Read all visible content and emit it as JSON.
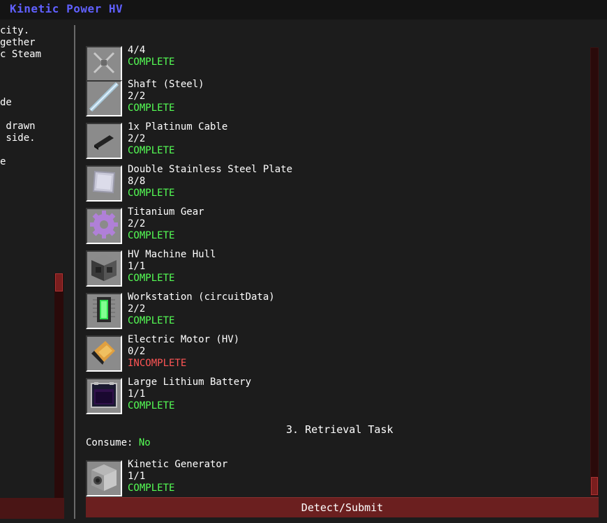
{
  "window": {
    "title": "Kinetic Power HV"
  },
  "description": {
    "lines": [
      "city.",
      "gether",
      "c Steam",
      "de",
      " drawn",
      " side.",
      "e"
    ]
  },
  "requirements": [
    {
      "icon": "rotor-icon",
      "name": "",
      "count": "4/4",
      "status": "COMPLETE"
    },
    {
      "icon": "steel-shaft-icon",
      "name": "Shaft (Steel)",
      "count": "2/2",
      "status": "COMPLETE"
    },
    {
      "icon": "platinum-cable-icon",
      "name": "1x Platinum Cable",
      "count": "2/2",
      "status": "COMPLETE"
    },
    {
      "icon": "steel-plate-icon",
      "name": "Double Stainless Steel Plate",
      "count": "8/8",
      "status": "COMPLETE"
    },
    {
      "icon": "titanium-gear-icon",
      "name": "Titanium Gear",
      "count": "2/2",
      "status": "COMPLETE"
    },
    {
      "icon": "machine-hull-icon",
      "name": "HV Machine Hull",
      "count": "1/1",
      "status": "COMPLETE"
    },
    {
      "icon": "workstation-icon",
      "name": "Workstation (circuitData)",
      "count": "2/2",
      "status": "COMPLETE"
    },
    {
      "icon": "electric-motor-icon",
      "name": "Electric Motor (HV)",
      "count": "0/2",
      "status": "INCOMPLETE"
    },
    {
      "icon": "battery-icon",
      "name": "Large Lithium Battery",
      "count": "1/1",
      "status": "COMPLETE"
    }
  ],
  "retrieval": {
    "title": "3. Retrieval Task",
    "consume_label": "Consume:",
    "consume_value": "No",
    "items": [
      {
        "icon": "kinetic-generator-icon",
        "name": "Kinetic Generator",
        "count": "1/1",
        "status": "COMPLETE"
      }
    ]
  },
  "submit_label": "Detect/Submit",
  "colors": {
    "title": "#6060ff",
    "complete": "#55ff55",
    "incomplete": "#ff5555",
    "button": "#6b1f1f"
  }
}
